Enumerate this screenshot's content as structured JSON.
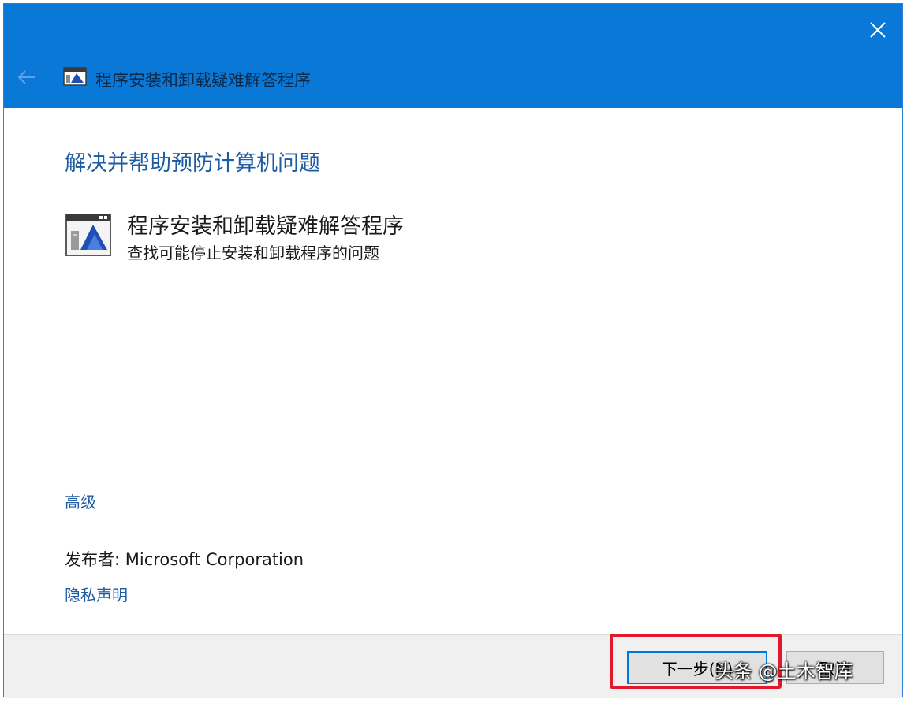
{
  "window": {
    "title": "程序安装和卸载疑难解答程序",
    "back_icon": "back-arrow-icon",
    "close_icon": "close-icon",
    "accent_color": "#0a78d7"
  },
  "main": {
    "heading": "解决并帮助预防计算机问题",
    "item": {
      "title": "程序安装和卸载疑难解答程序",
      "description": "查找可能停止安装和卸载程序的问题",
      "icon": "troubleshooter-icon"
    },
    "advanced_link": "高级",
    "publisher": "发布者: Microsoft Corporation",
    "privacy_link": "隐私声明"
  },
  "footer": {
    "next_label": "下一步(N)",
    "cancel_label": "取消"
  },
  "watermark": "头条 @土木智库",
  "colors": {
    "link": "#1d5ba3",
    "highlight": "#e0192c"
  }
}
